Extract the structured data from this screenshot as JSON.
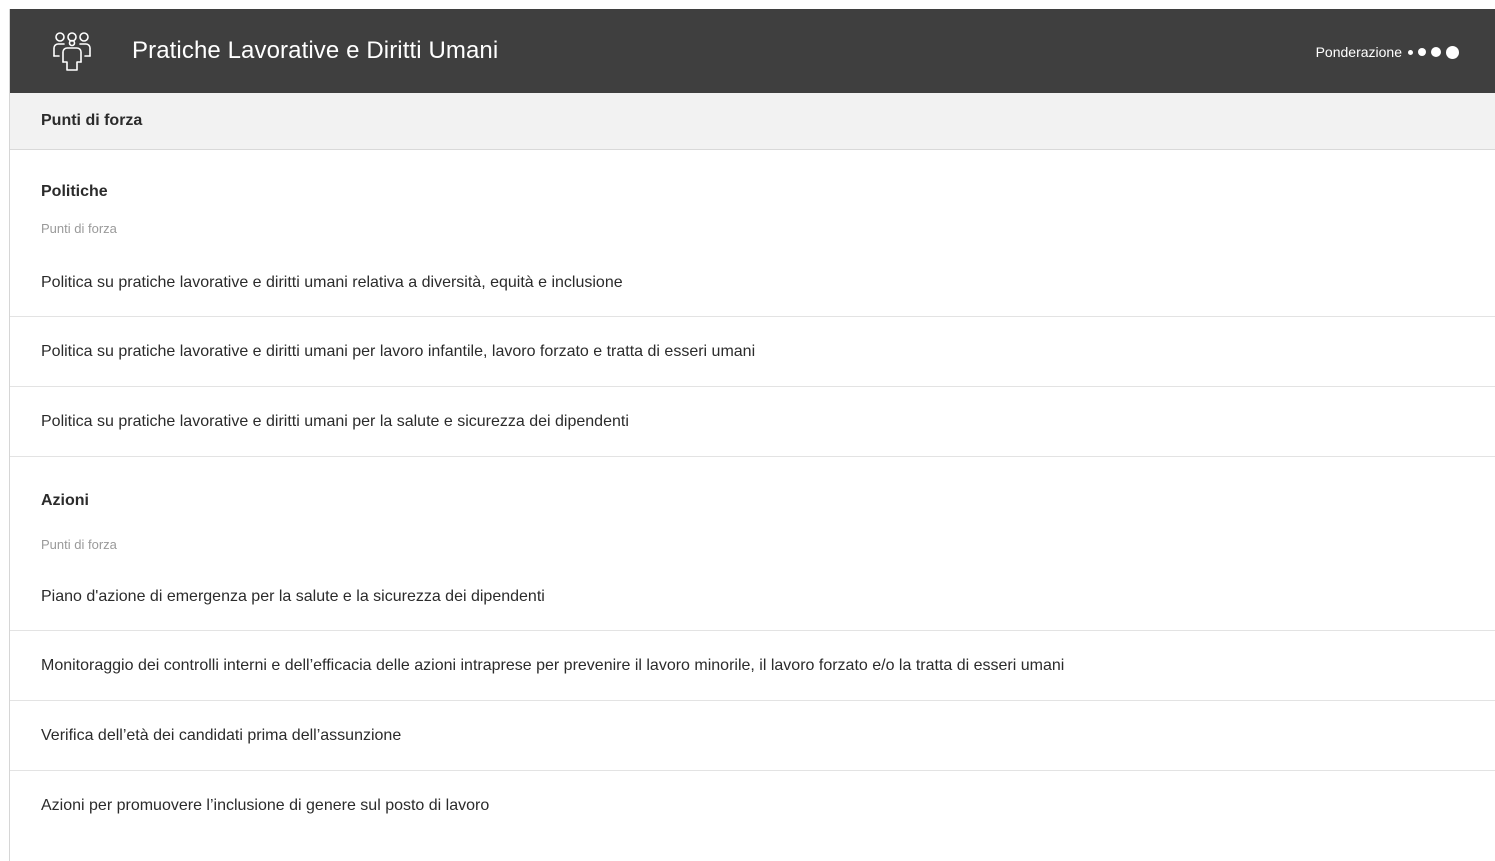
{
  "header": {
    "icon": "people-group-icon",
    "title": "Pratiche Lavorative e Diritti Umani",
    "weighting_label": "Ponderazione",
    "weighting_level": 4,
    "weighting_max": 4
  },
  "strengths_bar": {
    "label": "Punti di forza"
  },
  "sections": [
    {
      "title": "Politiche",
      "subtitle": "Punti di forza",
      "items": [
        "Politica su pratiche lavorative e diritti umani relativa a diversità, equità e inclusione",
        "Politica su pratiche lavorative e diritti umani per lavoro infantile, lavoro forzato e tratta di esseri umani",
        "Politica su pratiche lavorative e diritti umani per la salute e sicurezza dei dipendenti"
      ]
    },
    {
      "title": "Azioni",
      "subtitle": "Punti di forza",
      "items": [
        "Piano d'azione di emergenza per la salute e la sicurezza dei dipendenti",
        "Monitoraggio dei controlli interni e dell’efficacia delle azioni intraprese per prevenire il lavoro minorile, il lavoro forzato e/o la tratta di esseri umani",
        "Verifica dell’età dei candidati prima dell’assunzione",
        "Azioni per promuovere l’inclusione di genere sul posto di lavoro"
      ]
    }
  ]
}
